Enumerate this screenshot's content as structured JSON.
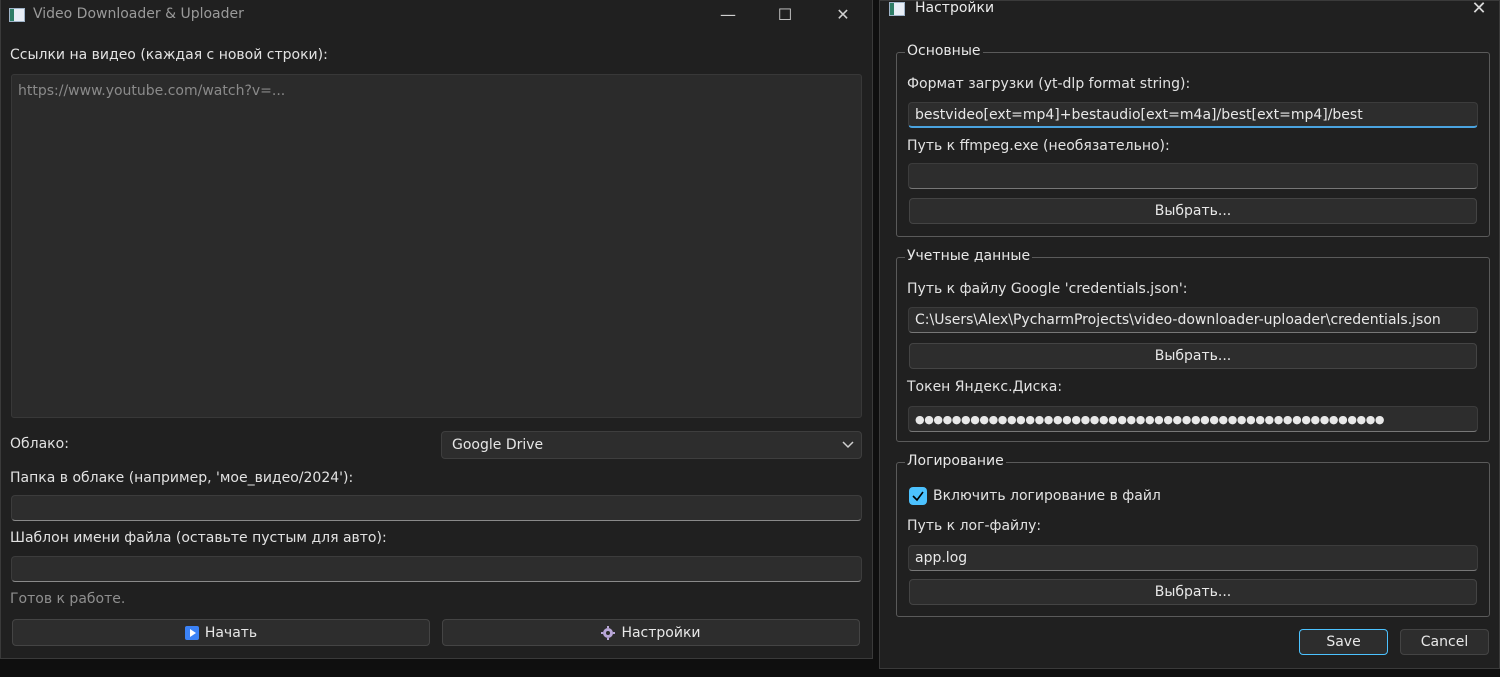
{
  "main_window": {
    "title": "Video Downloader & Uploader",
    "controls": {
      "minimize": "—",
      "maximize": "☐",
      "close": "✕"
    },
    "links_label": "Ссылки на видео (каждая с новой строки):",
    "links_placeholder": "https://www.youtube.com/watch?v=...",
    "cloud_label": "Облако:",
    "cloud_selected": "Google Drive",
    "folder_label": "Папка в облаке (например, 'мое_видео/2024'):",
    "folder_value": "",
    "template_label": "Шаблон имени файла (оставьте пустым для авто):",
    "template_value": "",
    "status": "Готов к работе.",
    "start_button": "Начать",
    "settings_button": "Настройки"
  },
  "settings_dialog": {
    "title": "Настройки",
    "close": "✕",
    "basic": {
      "title": "Основные",
      "format_label": "Формат загрузки (yt-dlp format string):",
      "format_value": "bestvideo[ext=mp4]+bestaudio[ext=m4a]/best[ext=mp4]/best",
      "ffmpeg_label": "Путь к ffmpeg.exe (необязательно):",
      "ffmpeg_value": "",
      "browse": "Выбрать..."
    },
    "credentials": {
      "title": "Учетные данные",
      "google_label": "Путь к файлу Google 'credentials.json':",
      "google_value": "C:\\Users\\Alex\\PycharmProjects\\video-downloader-uploader\\credentials.json",
      "browse": "Выбрать...",
      "yandex_label": "Токен Яндекс.Диска:",
      "yandex_value": "●●●●●●●●●●●●●●●●●●●●●●●●●●●●●●●●●●●●●●●●●●●●●●●●●●●"
    },
    "logging": {
      "title": "Логирование",
      "enable_label": "Включить логирование в файл",
      "enabled": true,
      "logfile_label": "Путь к лог-файлу:",
      "logfile_value": "app.log",
      "browse": "Выбрать..."
    },
    "save": "Save",
    "cancel": "Cancel"
  },
  "colors": {
    "accent": "#4cc2ff",
    "background": "#202020",
    "field": "#2d2d2d"
  }
}
